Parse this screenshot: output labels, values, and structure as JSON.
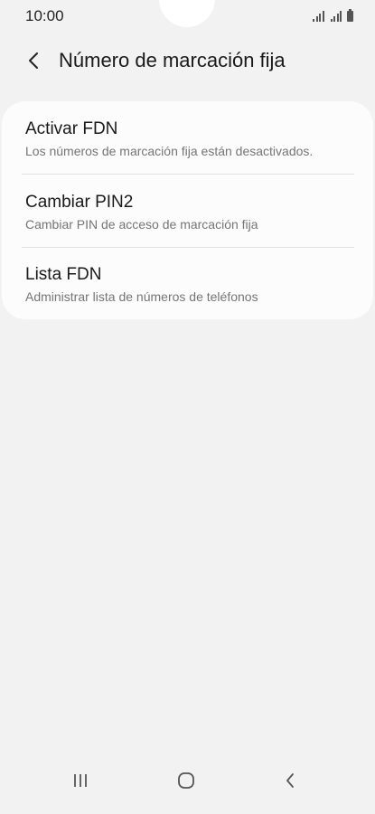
{
  "status_bar": {
    "time": "10:00"
  },
  "header": {
    "title": "Número de marcación fija",
    "back_icon": "chevron-left-icon"
  },
  "settings": {
    "items": [
      {
        "title": "Activar FDN",
        "subtitle": "Los números de marcación fija están desactivados."
      },
      {
        "title": "Cambiar PIN2",
        "subtitle": "Cambiar PIN de acceso de marcación fija"
      },
      {
        "title": "Lista FDN",
        "subtitle": "Administrar lista de números de teléfonos"
      }
    ]
  },
  "nav_bar": {
    "recent_icon": "recent-apps-icon",
    "home_icon": "home-icon",
    "back_icon": "back-icon"
  },
  "colors": {
    "background": "#f2f2f2",
    "card": "#fcfcfc",
    "text_primary": "#1a1a1a",
    "text_secondary": "#757575",
    "divider": "#e3e3e3"
  }
}
